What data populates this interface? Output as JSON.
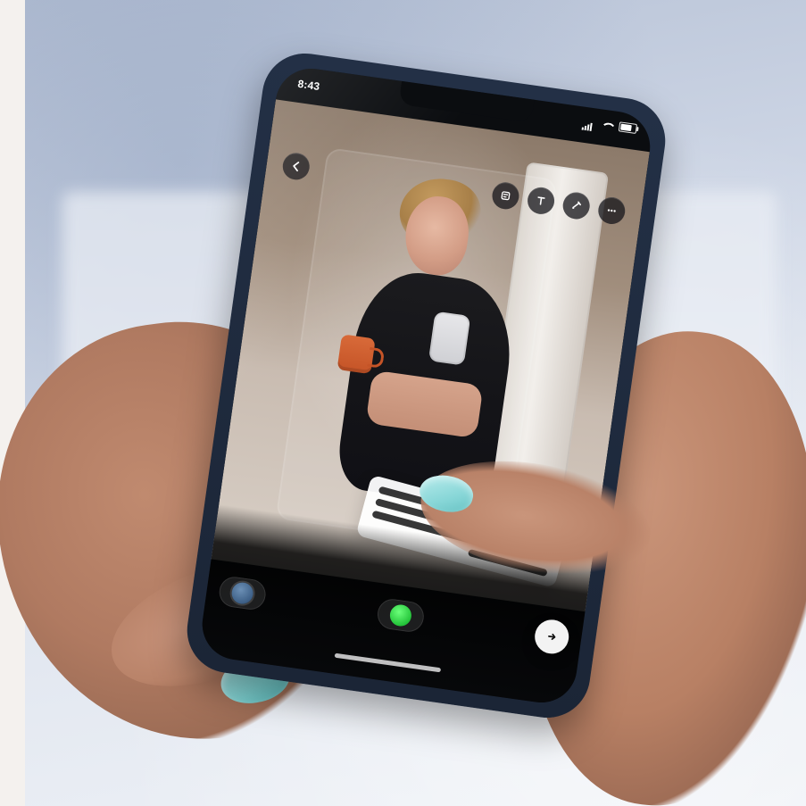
{
  "status_bar": {
    "time": "8:43"
  },
  "bottom_bar": {
    "avatar_icon": "avatar-icon",
    "close_friends_icon": "close-friends-icon",
    "send_icon": "send-icon"
  },
  "top_controls": {
    "back_icon": "back-icon",
    "icons": [
      {
        "name": "stickers-icon"
      },
      {
        "name": "text-icon"
      },
      {
        "name": "draw-icon"
      },
      {
        "name": "more-icon"
      }
    ]
  },
  "colors": {
    "nail_polish": "#7bcfcf",
    "phone_frame": "#1b2536",
    "green_accent": "#24c43a"
  }
}
